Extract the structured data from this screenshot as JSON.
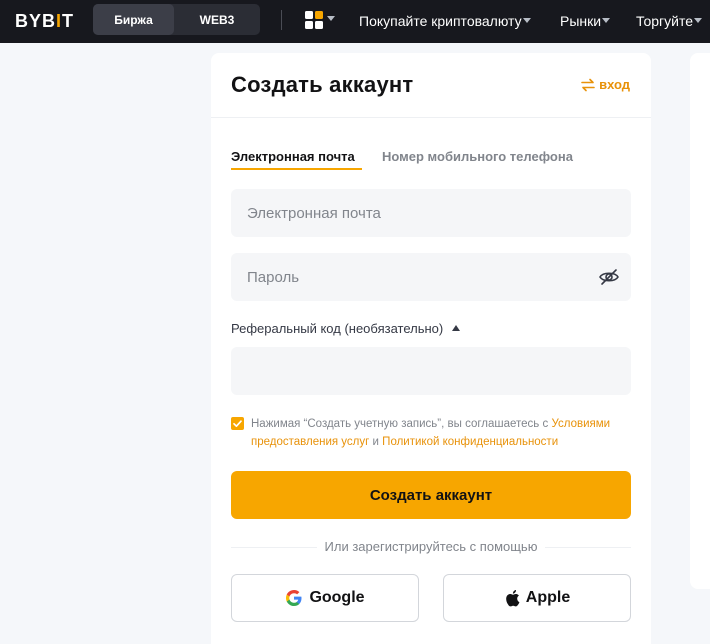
{
  "header": {
    "logo_left": "BYB",
    "logo_bar": "I",
    "logo_right": "T",
    "tabs": [
      {
        "label": "Биржа",
        "active": true
      },
      {
        "label": "WEB3",
        "active": false
      }
    ],
    "nav": [
      {
        "label": "Покупайте криптовалюту"
      },
      {
        "label": "Рынки"
      },
      {
        "label": "Торгуйте"
      }
    ],
    "grid_icon_colors": [
      "#ffffff",
      "#f7a600",
      "#ffffff",
      "#ffffff"
    ]
  },
  "card": {
    "title": "Создать аккаунт",
    "login_label": "вход",
    "tabs": [
      {
        "label": "Электронная почта",
        "active": true
      },
      {
        "label": "Номер мобильного телефона",
        "active": false
      }
    ],
    "email_placeholder": "Электронная почта",
    "password_placeholder": "Пароль",
    "referral_label": "Реферальный код (необязательно)",
    "referral_value": "",
    "consent": {
      "prefix": "Нажимая “Создать учетную запись”, вы соглашаетесь с ",
      "terms_link": "Условиями предоставления услуг",
      "middle": " и ",
      "privacy_link": "Политикой конфиденциальности",
      "checked": true
    },
    "submit_label": "Создать аккаунт",
    "or_text": "Или зарегистрируйтесь с помощью",
    "social": [
      {
        "label": "Google",
        "icon": "google-icon"
      },
      {
        "label": "Apple",
        "icon": "apple-icon"
      }
    ]
  },
  "colors": {
    "accent": "#f7a600",
    "link": "#e8920a",
    "header_bg": "#17181e",
    "page_bg": "#f5f7fa"
  }
}
